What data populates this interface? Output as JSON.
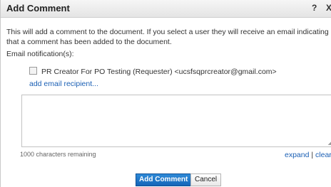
{
  "dialog": {
    "title": "Add Comment",
    "help_label": "?",
    "close_label": "X",
    "description": "This will add a comment to the document. If you select a user they will receive an email indicating that a comment has been added to the document.",
    "notification_label": "Email notification(s):",
    "recipient": {
      "label": "PR Creator For PO Testing (Requester) <ucsfsqprcreator@gmail.com>",
      "checked": false
    },
    "add_recipient_label": "add email recipient...",
    "comment": {
      "value": "",
      "remaining_text": "1000 characters remaining"
    },
    "expand_label": "expand",
    "separator": "|",
    "clear_label": "clear",
    "buttons": {
      "add_comment": "Add Comment",
      "cancel": "Cancel"
    }
  }
}
